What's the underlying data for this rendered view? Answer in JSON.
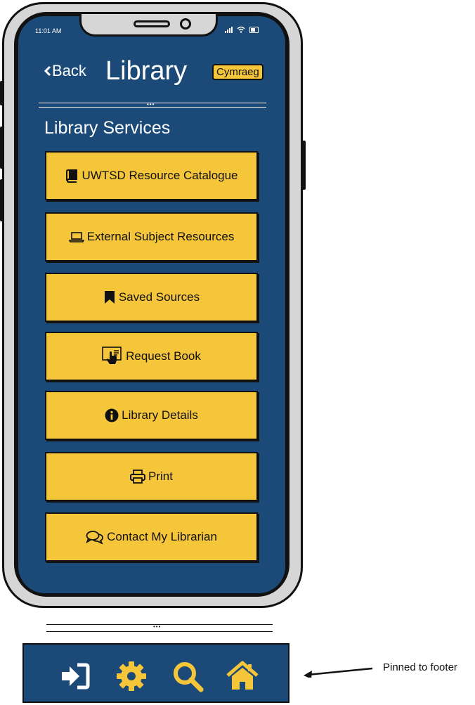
{
  "status_bar": {
    "time": "11:01 AM"
  },
  "header": {
    "back_label": "Back",
    "title": "Library",
    "language_button": "Cymraeg"
  },
  "section_title": "Library Services",
  "services": [
    {
      "label": "UWTSD Resource Catalogue",
      "icon": "book-icon"
    },
    {
      "label": "External Subject Resources",
      "icon": "laptop-icon"
    },
    {
      "label": "Saved Sources",
      "icon": "bookmark-icon"
    },
    {
      "label": "Request Book",
      "icon": "touch-request-icon"
    },
    {
      "label": "Library Details",
      "icon": "info-circle-icon"
    },
    {
      "label": "Print",
      "icon": "printer-icon"
    },
    {
      "label": "Contact My Librarian",
      "icon": "chat-bubbles-icon"
    }
  ],
  "footer_nav": [
    {
      "icon": "sign-in-icon"
    },
    {
      "icon": "gear-icon"
    },
    {
      "icon": "search-icon"
    },
    {
      "icon": "home-icon"
    }
  ],
  "annotation": "Pinned to footer",
  "colors": {
    "screen_background": "#1c4a78",
    "button_yellow": "#f5c53a",
    "footer_icon_yellow": "#f5c53a"
  }
}
